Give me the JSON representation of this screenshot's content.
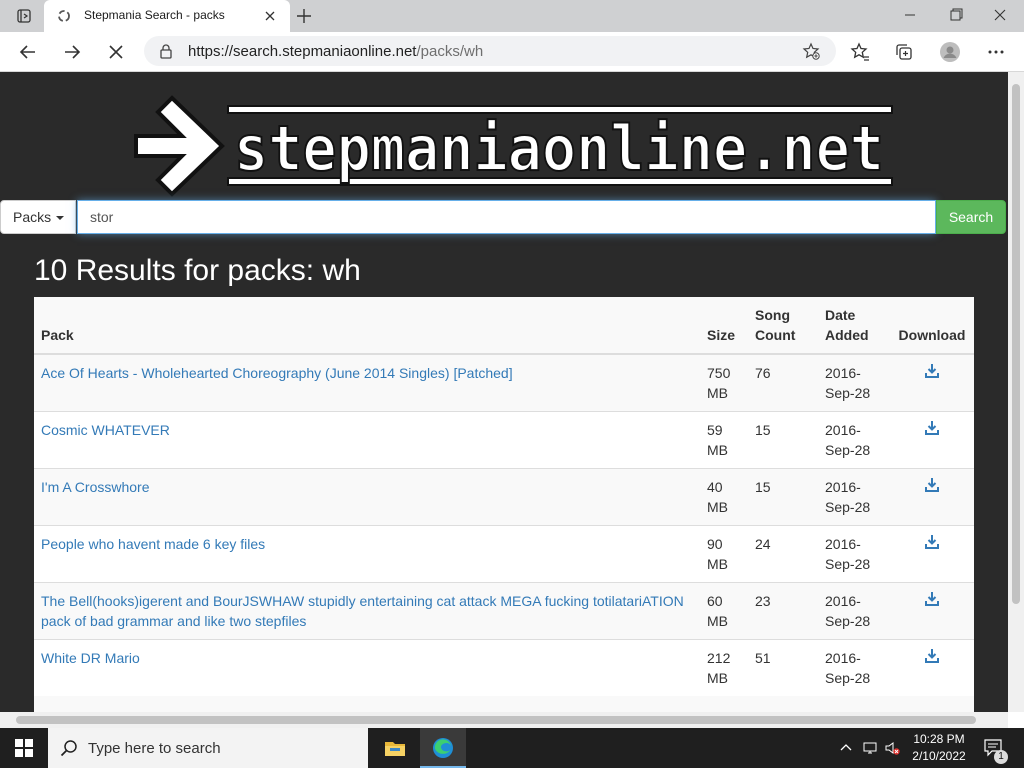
{
  "browser": {
    "tab_title": "Stepmania Search - packs",
    "url_host": "https://search.stepmaniaonline.net",
    "url_path": "/packs/wh"
  },
  "site": {
    "logo_text": "stepmaniaonline.net",
    "search": {
      "category": "Packs",
      "query": "stor",
      "button_label": "Search"
    },
    "results_heading": "10 Results for packs: wh",
    "table": {
      "headers": {
        "pack": "Pack",
        "size": "Size",
        "song_count_1": "Song",
        "song_count_2": "Count",
        "date_1": "Date",
        "date_2": "Added",
        "download": "Download"
      },
      "rows": [
        {
          "pack": "Ace Of Hearts - Wholehearted Choreography (June 2014 Singles) [Patched]",
          "size_1": "750",
          "size_2": "MB",
          "songs": "76",
          "date_1": "2016-",
          "date_2": "Sep-28"
        },
        {
          "pack": "Cosmic WHATEVER",
          "size_1": "59",
          "size_2": "MB",
          "songs": "15",
          "date_1": "2016-",
          "date_2": "Sep-28"
        },
        {
          "pack": "I'm A Crosswhore",
          "size_1": "40",
          "size_2": "MB",
          "songs": "15",
          "date_1": "2016-",
          "date_2": "Sep-28"
        },
        {
          "pack": "People who havent made 6 key files",
          "size_1": "90",
          "size_2": "MB",
          "songs": "24",
          "date_1": "2016-",
          "date_2": "Sep-28"
        },
        {
          "pack": "The Bell(hooks)igerent and BourJSWHAW stupidly entertaining cat attack MEGA fucking totilatariATION pack of bad grammar and like two stepfiles",
          "size_1": "60",
          "size_2": "MB",
          "songs": "23",
          "date_1": "2016-",
          "date_2": "Sep-28"
        },
        {
          "pack": "White DR Mario",
          "size_1": "212",
          "size_2": "MB",
          "songs": "51",
          "date_1": "2016-",
          "date_2": "Sep-28"
        }
      ]
    }
  },
  "taskbar": {
    "search_placeholder": "Type here to search",
    "time": "10:28 PM",
    "date": "2/10/2022",
    "notification_count": "1"
  },
  "colors": {
    "page_bg": "#2a2a2a",
    "link": "#337ab7",
    "search_button": "#5cb85c"
  }
}
